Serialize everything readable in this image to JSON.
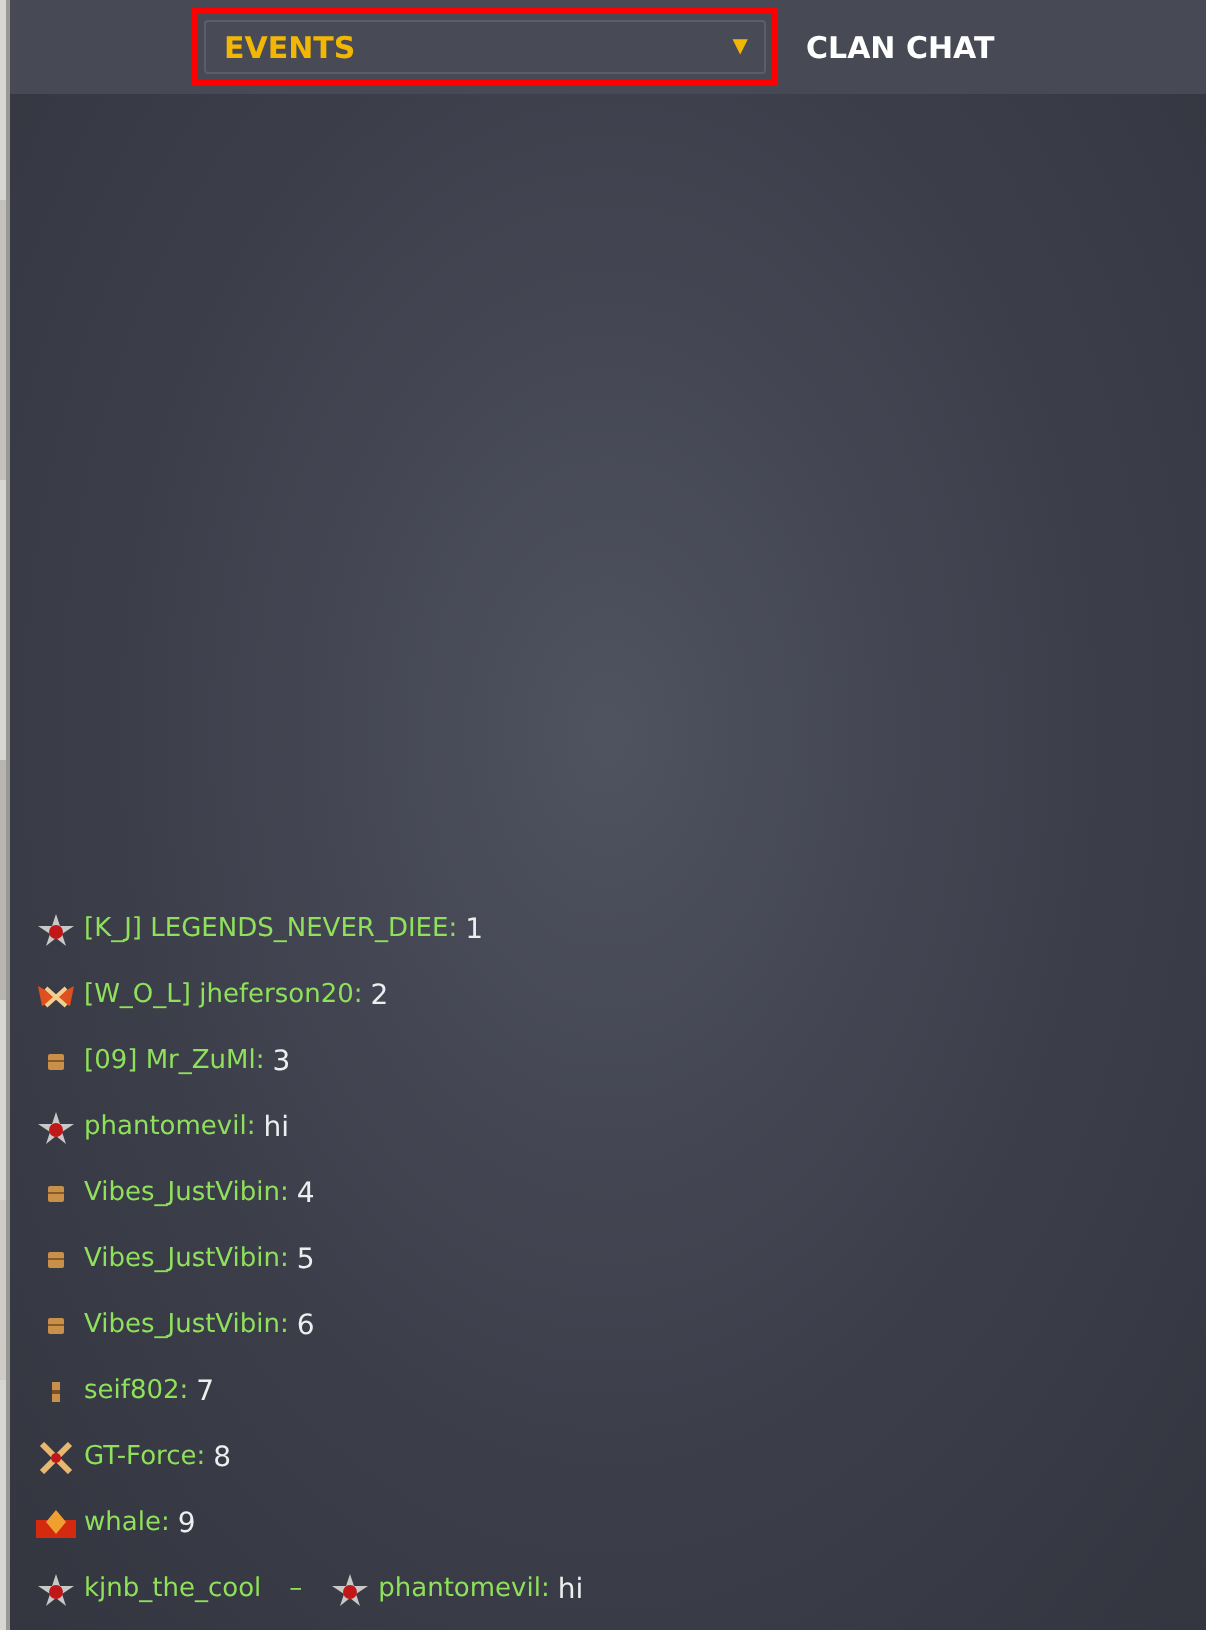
{
  "header": {
    "dropdown": {
      "label": "EVENTS",
      "caret": "▼",
      "highlighted": true
    },
    "tab": {
      "label": "CLAN CHAT"
    }
  },
  "messages": [
    {
      "sender": {
        "kind": "star",
        "name": "[K_J] LEGENDS_NEVER_DIEE:"
      },
      "text": "1"
    },
    {
      "sender": {
        "kind": "wings",
        "name": "[W_O_L] jheferson20:"
      },
      "text": "2"
    },
    {
      "sender": {
        "kind": "box",
        "name": "[09] Mr_ZuMl:"
      },
      "text": "3"
    },
    {
      "sender": {
        "kind": "star",
        "name": "phantomevil:"
      },
      "text": "hi"
    },
    {
      "sender": {
        "kind": "box",
        "name": "Vibes_JustVibin:"
      },
      "text": "4"
    },
    {
      "sender": {
        "kind": "box",
        "name": "Vibes_JustVibin:"
      },
      "text": "5"
    },
    {
      "sender": {
        "kind": "box",
        "name": "Vibes_JustVibin:"
      },
      "text": "6"
    },
    {
      "sender": {
        "kind": "pip",
        "name": "seif802:"
      },
      "text": "7"
    },
    {
      "sender": {
        "kind": "cross",
        "name": "GT-Force:"
      },
      "text": "8"
    },
    {
      "sender": {
        "kind": "banner",
        "name": "whale:"
      },
      "text": "9"
    },
    {
      "sender": {
        "kind": "star",
        "name": "kjnb_the_cool"
      },
      "dash": "–",
      "recipient": {
        "kind": "star",
        "name": "phantomevil:"
      },
      "text": "hi"
    }
  ]
}
